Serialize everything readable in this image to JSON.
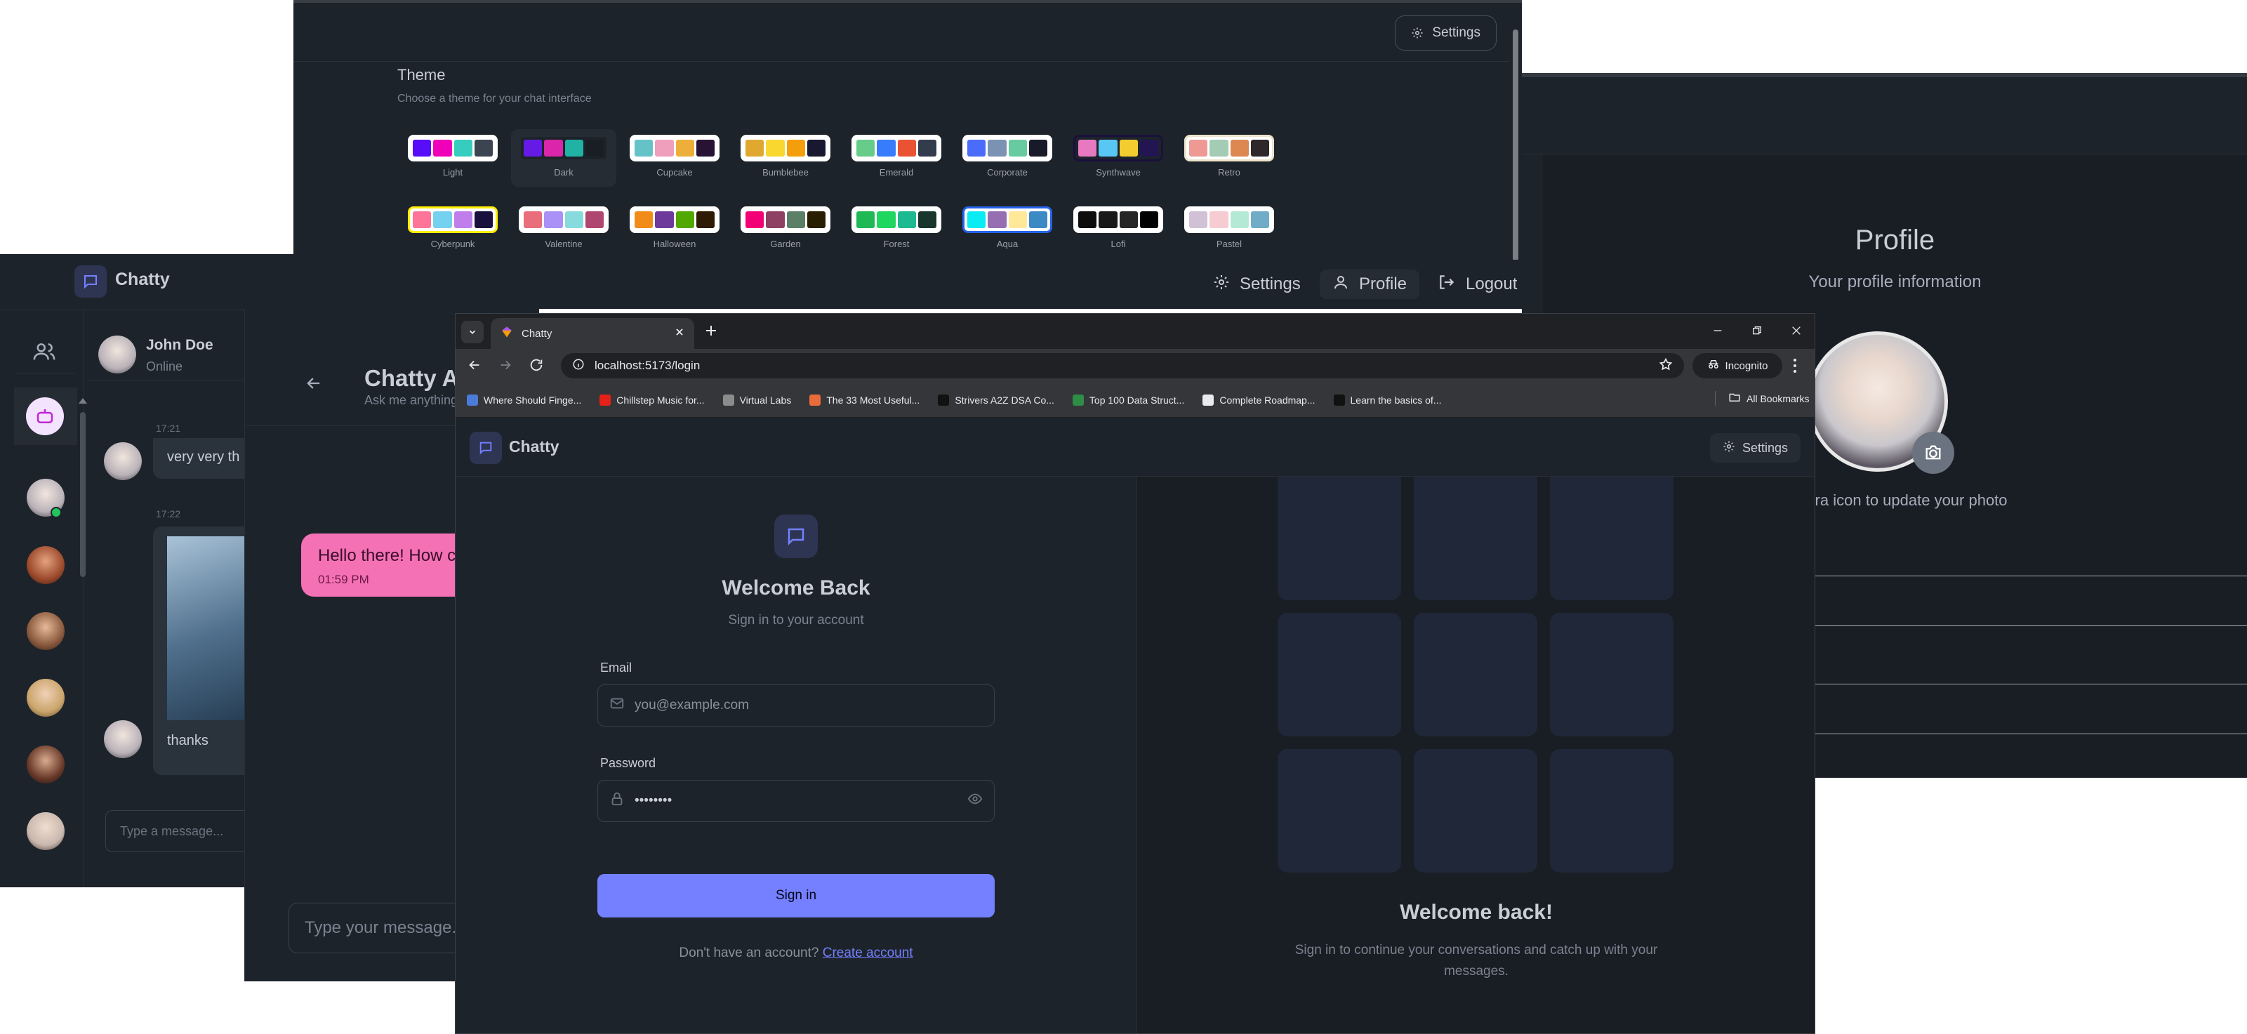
{
  "theme_window": {
    "settings_label": "Settings",
    "title": "Theme",
    "subtitle": "Choose a theme for your chat interface",
    "themes": [
      {
        "name": "Light",
        "colors": [
          "#570df8",
          "#f000b8",
          "#37cdbe",
          "#3d4451"
        ]
      },
      {
        "name": "Dark",
        "colors": [
          "#661ae6",
          "#d926aa",
          "#1fb2a5",
          "#191d24"
        ]
      },
      {
        "name": "Cupcake",
        "colors": [
          "#65c3c8",
          "#ef9fbc",
          "#eeaf3a",
          "#291334"
        ]
      },
      {
        "name": "Bumblebee",
        "colors": [
          "#e0a82e",
          "#f9d72f",
          "#f59e0b",
          "#181830"
        ]
      },
      {
        "name": "Emerald",
        "colors": [
          "#66cc8a",
          "#377cfb",
          "#ea5234",
          "#333c4d"
        ]
      },
      {
        "name": "Corporate",
        "colors": [
          "#4b6bfb",
          "#7b92b2",
          "#67cba0",
          "#181a2a"
        ]
      },
      {
        "name": "Synthwave",
        "colors": [
          "#e779c1",
          "#58c7f3",
          "#f3cc30",
          "#221551"
        ]
      },
      {
        "name": "Retro",
        "colors": [
          "#ef9995",
          "#a4cbb4",
          "#dc8850",
          "#2e282a"
        ]
      },
      {
        "name": "Cyberpunk",
        "colors": [
          "#ff7598",
          "#75d1f0",
          "#c07eec",
          "#1a103d"
        ]
      },
      {
        "name": "Valentine",
        "colors": [
          "#e96d7b",
          "#a991f7",
          "#88dbdd",
          "#af4670"
        ]
      },
      {
        "name": "Halloween",
        "colors": [
          "#f28c18",
          "#6d3a9c",
          "#51a800",
          "#2f1b05"
        ]
      },
      {
        "name": "Garden",
        "colors": [
          "#f40076",
          "#8e4162",
          "#5c7f67",
          "#291e00"
        ]
      },
      {
        "name": "Forest",
        "colors": [
          "#1eb854",
          "#1fd65f",
          "#1db990",
          "#19362d"
        ]
      },
      {
        "name": "Aqua",
        "colors": [
          "#09ecf3",
          "#966fb3",
          "#ffe999",
          "#3b8ac4"
        ]
      },
      {
        "name": "Lofi",
        "colors": [
          "#0d0d0d",
          "#1a1919",
          "#262626",
          "#000000"
        ]
      },
      {
        "name": "Pastel",
        "colors": [
          "#d1c1d7",
          "#f6cbd1",
          "#b4e9d6",
          "#70acc7"
        ]
      }
    ]
  },
  "nav_strip": {
    "settings": "Settings",
    "profile": "Profile",
    "logout": "Logout"
  },
  "profile_window": {
    "title": "Profile",
    "subtitle": "Your profile information",
    "camera_hint": "mera icon to update your photo"
  },
  "chat_window": {
    "app_name": "Chatty",
    "contact_name": "John Doe",
    "contact_status": "Online",
    "messages": [
      {
        "time": "17:21",
        "text": "very very th"
      },
      {
        "time": "17:22",
        "text": ""
      },
      {
        "time": "",
        "text": "thanks"
      }
    ],
    "input_placeholder": "Type a message..."
  },
  "ai_window": {
    "title": "Chatty AI",
    "subtitle": "Ask me anything",
    "bubble_text": "Hello there! How c",
    "bubble_time": "01:59 PM",
    "input_placeholder": "Type your message..."
  },
  "browser": {
    "tab_title": "Chatty",
    "url": "localhost:5173/login",
    "incognito": "Incognito",
    "bookmarks": [
      {
        "label": "Where Should Finge...",
        "color": "#4a7bd8"
      },
      {
        "label": "Chillstep Music for...",
        "color": "#e62117"
      },
      {
        "label": "Virtual Labs",
        "color": "#8c8c8c"
      },
      {
        "label": "The 33 Most Useful...",
        "color": "#e86b3a"
      },
      {
        "label": "Strivers A2Z DSA Co...",
        "color": "#111111"
      },
      {
        "label": "Top 100 Data Struct...",
        "color": "#2f8d46"
      },
      {
        "label": "Complete Roadmap...",
        "color": "#e8eaed"
      },
      {
        "label": "Learn the basics of...",
        "color": "#111111"
      }
    ],
    "all_bookmarks": "All Bookmarks",
    "app_name": "Chatty",
    "settings_label": "Settings",
    "login": {
      "title": "Welcome Back",
      "subtitle": "Sign in to your account",
      "email_label": "Email",
      "email_placeholder": "you@example.com",
      "password_label": "Password",
      "password_value": "••••••••",
      "sign_in": "Sign in",
      "no_account": "Don't have an account?",
      "create_account": "Create account"
    },
    "right_panel": {
      "title": "Welcome back!",
      "line1": "Sign in to continue your conversations and catch up with your",
      "line2": "messages."
    }
  },
  "colors": {
    "accent": "#7480ff",
    "pink_bubble": "#f471b5",
    "bg": "#1d232a"
  }
}
